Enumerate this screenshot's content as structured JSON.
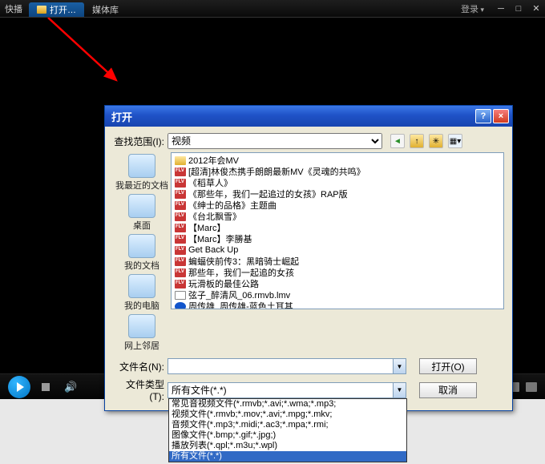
{
  "app": {
    "title": "快播",
    "tab_open": "打开…",
    "tab_library": "媒体库",
    "login": "登录"
  },
  "dialog": {
    "title": "打开",
    "look_in_label": "查找范围(I):",
    "look_in_value": "视频",
    "places": {
      "recent": "我最近的文档",
      "desktop": "桌面",
      "mydocs": "我的文档",
      "mycomputer": "我的电脑",
      "network": "网上邻居"
    },
    "files": [
      {
        "icon": "folder",
        "name": "2012年会MV"
      },
      {
        "icon": "flv",
        "name": "[超清]林俊杰携手朗朗最新MV《灵魂的共鸣》"
      },
      {
        "icon": "flv",
        "name": "《稻草人》"
      },
      {
        "icon": "flv",
        "name": "《那些年，我们一起追过的女孩》RAP版"
      },
      {
        "icon": "flv",
        "name": "《绅士的品格》主题曲"
      },
      {
        "icon": "flv",
        "name": "《台北飘雪》"
      },
      {
        "icon": "flv",
        "name": "【Marc】"
      },
      {
        "icon": "flv",
        "name": "【Marc】李勝基"
      },
      {
        "icon": "flv",
        "name": "Get Back Up"
      },
      {
        "icon": "flv",
        "name": "蝙蝠侠前传3：黑暗骑士崛起"
      },
      {
        "icon": "flv",
        "name": "那些年，我们一起追的女孩"
      },
      {
        "icon": "flv",
        "name": "玩滑板的最佳公路"
      },
      {
        "icon": "list",
        "name": "弦子_醉清风_06.rmvb.lmv"
      },
      {
        "icon": "rm",
        "name": "周传雄_周传雄-蓝色土耳其"
      }
    ],
    "file_name_label": "文件名(N):",
    "file_name_value": "",
    "file_type_label": "文件类型(T):",
    "file_type_value": "所有文件(*.*)",
    "open_btn": "打开(O)",
    "cancel_btn": "取消",
    "type_options": [
      "常见音视频文件(*.rmvb;*.avi;*.wma;*.mp3;",
      "视频文件(*.rmvb;*.mov;*.avi;*.mpg;*.mkv;",
      "音频文件(*.mp3;*.midi;*.ac3;*.mpa;*.rmi;",
      "图像文件(*.bmp;*.gif;*.jpg;)",
      "播放列表(*.qpl;*.m3u;*.wpl)",
      "所有文件(*.*)"
    ],
    "type_selected_index": 5
  }
}
